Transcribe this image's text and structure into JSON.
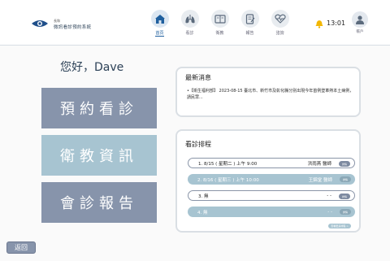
{
  "header": {
    "brand_small": "長和",
    "brand_main": "微訊看診預約系統",
    "nav": [
      {
        "label": "首頁",
        "icon": "home-icon"
      },
      {
        "label": "看診",
        "icon": "lungs-icon"
      },
      {
        "label": "衛教",
        "icon": "book-icon"
      },
      {
        "label": "報告",
        "icon": "report-icon"
      },
      {
        "label": "諮詢",
        "icon": "heart-pulse-icon"
      }
    ],
    "time": "13:01",
    "account_label": "帳戶"
  },
  "greeting": "您好，Dave",
  "buttons": {
    "appointment": "預約看診",
    "education": "衛教資訊",
    "report": "會診報告"
  },
  "news": {
    "title": "最新消息",
    "text": "•【衛生福利部】 2023-08-15 臺北市、新竹市及彰化縣分別出現今年首例登革熱本土病例，請民眾..."
  },
  "schedule": {
    "title": "看診排程",
    "rows": [
      {
        "text": "1. 8/15 ( 星期二 ) 上午 9:00",
        "doctor": "洪雨燕 醫師",
        "action": "詳情"
      },
      {
        "text": "2. 8/16 ( 星期三 ) 上午 10:00",
        "doctor": "王錦堂 醫師",
        "action": "詳情"
      },
      {
        "text": "3. 無",
        "doctor": "- -",
        "action": "詳情"
      },
      {
        "text": "4. 無",
        "doctor": "- -",
        "action": "詳情"
      }
    ],
    "more_label": "查看更多排程 >"
  },
  "back_label": "返回",
  "colors": {
    "slate": "#8794ab",
    "light_blue": "#a7c4d1",
    "accent": "#1f5f9e"
  }
}
